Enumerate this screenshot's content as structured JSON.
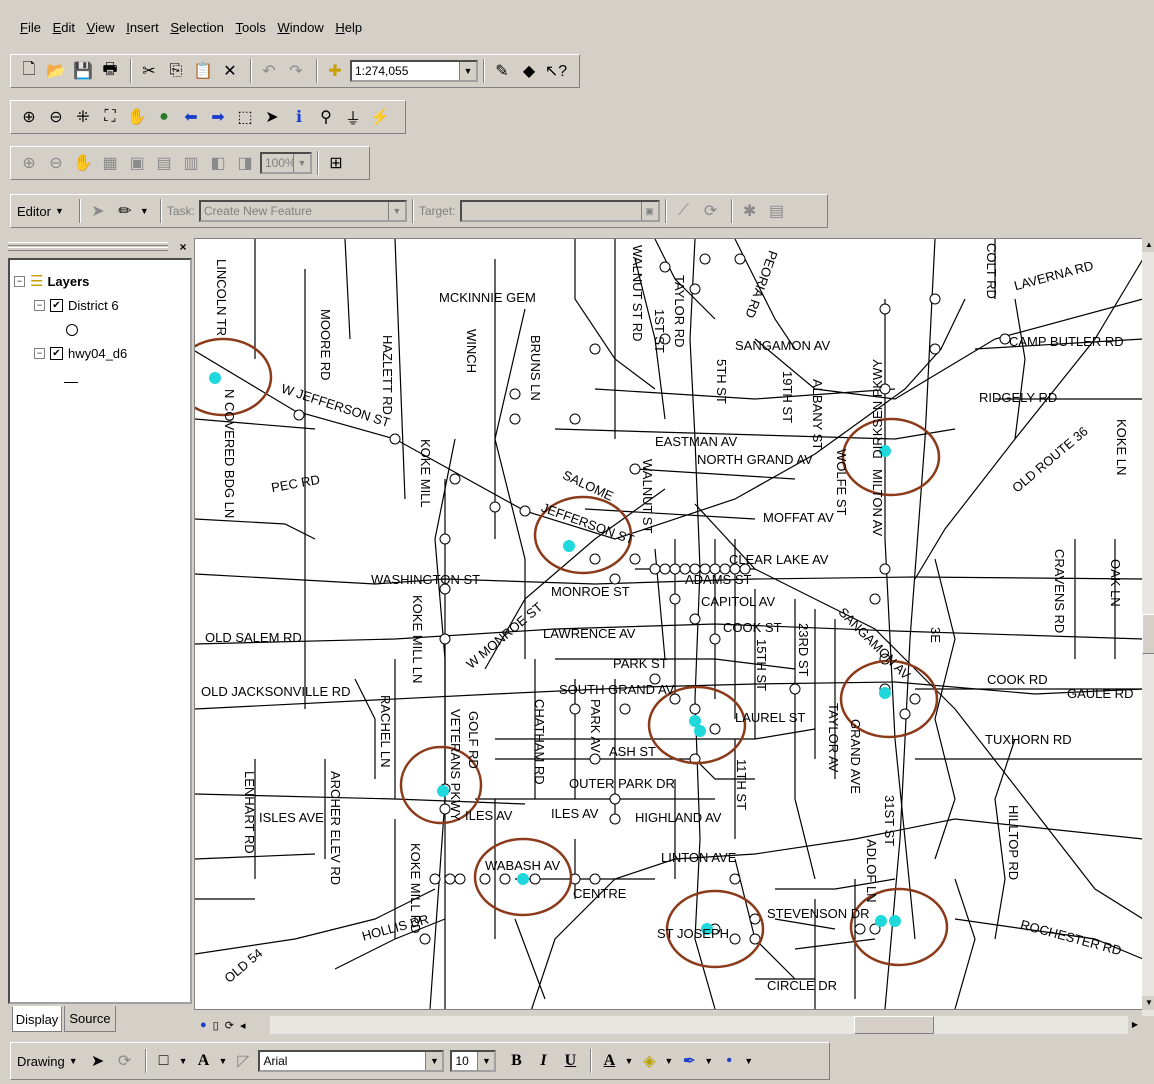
{
  "menu": [
    "File",
    "Edit",
    "View",
    "Insert",
    "Selection",
    "Tools",
    "Window",
    "Help"
  ],
  "standard_toolbar": {
    "scale": "1:274,055"
  },
  "layout_toolbar": {
    "zoom": "100%"
  },
  "editor_toolbar": {
    "editor_label": "Editor",
    "task_label": "Task:",
    "task_value": "Create New Feature",
    "target_label": "Target:"
  },
  "toc": {
    "root": "Layers",
    "layers": [
      {
        "name": "District 6",
        "checked": true,
        "symbol": "circle"
      },
      {
        "name": "hwy04_d6",
        "checked": true,
        "symbol": "line"
      }
    ],
    "tabs": [
      "Display",
      "Source"
    ]
  },
  "drawing_toolbar": {
    "label": "Drawing",
    "font": "Arial",
    "size": "10",
    "bold": "B",
    "italic": "I",
    "underline": "U",
    "text_tool": "A"
  },
  "map_labels": {
    "lincoln": "LINCOLN TR",
    "moore": "MOORE RD",
    "hazlett": "HAZLETT RD",
    "winch": "WINCH",
    "mckinnie": "MCKINNIE GEM",
    "bruns": "BRUNS LN",
    "walnut_rd": "WALNUT ST RD",
    "first_st": "1ST ST",
    "taylor_rd": "TAYLOR RD",
    "peoria": "PEORIA RD",
    "colt": "COLT RD",
    "laverna": "LAVERNA RD",
    "camp_butler": "CAMP BUTLER RD",
    "sangamon": "SANGAMON AV",
    "fifth": "5TH ST",
    "nineteenth": "19TH ST",
    "albany": "ALBANY ST",
    "dirksen": "DIRKSEN PKWY",
    "ridgely": "RIDGELY RD",
    "w_jefferson": "W JEFFERSON ST",
    "covered": "N COVERED BDG LN",
    "koke_mill": "KOKE MILL",
    "pec": "PEC RD",
    "eastman": "EASTMAN AV",
    "north_grand": "NORTH GRAND AV",
    "wolfe": "WOLFE ST",
    "milton": "MILTON AV",
    "old_route": "OLD ROUTE 36",
    "koke_ln": "KOKE LN",
    "moffat": "MOFFAT AV",
    "jefferson": "JEFFERSON ST",
    "salome": "SALOME",
    "walnut": "WALNUT ST",
    "clear_lake": "CLEAR LAKE AV",
    "washington": "WASHINGTON ST",
    "monroe": "MONROE ST",
    "adams": "ADAMS ST",
    "capitol": "CAPITOL AV",
    "w_monroe": "W MONROE ST",
    "old_salem": "OLD SALEM RD",
    "koke_mill_ln": "KOKE MILL LN",
    "lawrence": "LAWRENCE AV",
    "cook": "COOK ST",
    "fifteenth": "15TH ST",
    "twentythird": "23RD ST",
    "sangamon2": "SANGAMON AV",
    "cravens": "CRAVENS RD",
    "oak": "OAK LN",
    "old_jacksonville": "OLD JACKSONVILLE RD",
    "park": "PARK ST",
    "south_grand": "SOUTH GRAND AV",
    "cook_rd": "COOK RD",
    "gaule": "GAULE RD",
    "rachel": "RACHEL LN",
    "golf": "GOLF RD",
    "veterans": "VETERANS PKWY",
    "chatham": "CHATHAM RD",
    "park_av": "PARK AV",
    "laurel": "LAUREL ST",
    "taylor_av": "TAYLOR AV",
    "ash": "ASH ST",
    "eleventh": "11TH ST",
    "grand_ave": "GRAND AVE",
    "tuxhorn": "TUXHORN RD",
    "lenhart": "LENHART RD",
    "archer": "ARCHER ELEV RD",
    "isles": "ISLES AVE",
    "iles": "ILES AV",
    "iles2": "ILES AV",
    "outer_park": "OUTER PARK DR",
    "highland": "HIGHLAND AV",
    "thirtyfirst": "31ST ST",
    "hilltop": "HILLTOP RD",
    "wabash": "WABASH AV",
    "linton": "LINTON AVE",
    "koke_mill_rd": "KOKE MILL RD",
    "centre": "CENTRE",
    "stevenson": "STEVENSON DR",
    "adlof": "ADLOF LN",
    "rochester": "ROCHESTER RD",
    "hollis": "HOLLIS DR",
    "st_joseph": "ST JOSEPH",
    "circle": "CIRCLE DR",
    "old_54": "OLD 54",
    "third_e": "3E"
  }
}
